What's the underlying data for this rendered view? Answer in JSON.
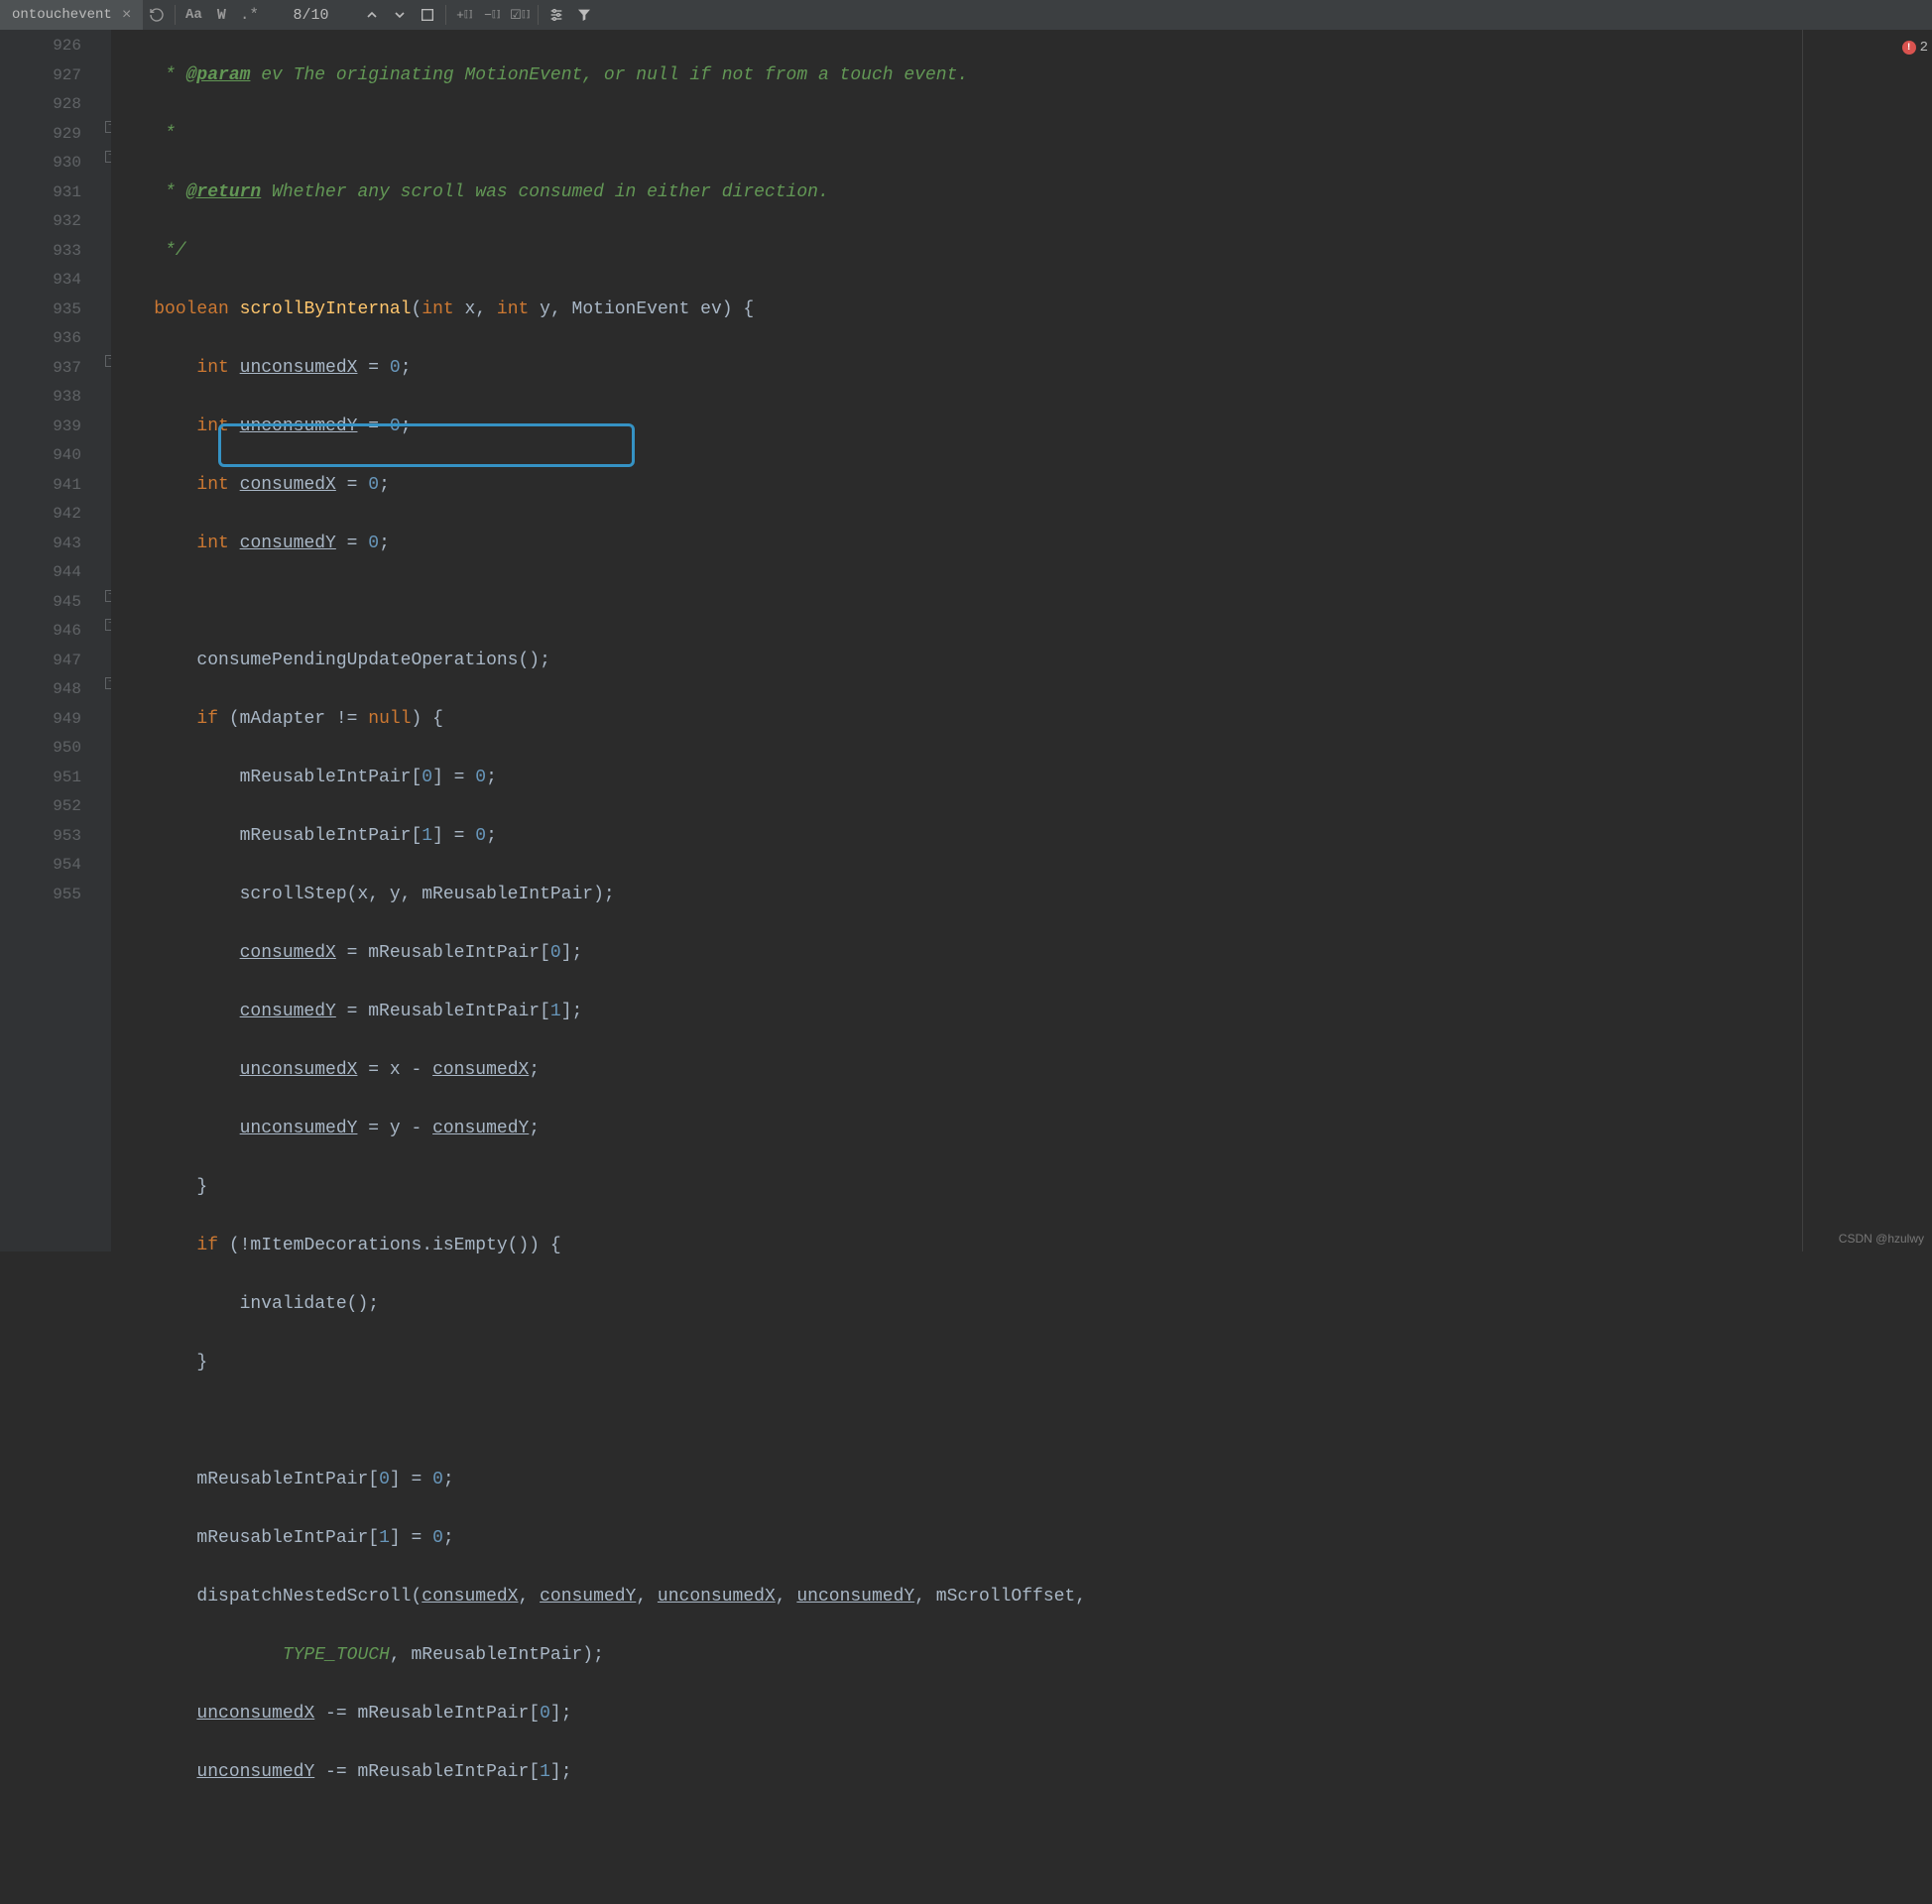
{
  "tab": {
    "label": "ontouchevent"
  },
  "search": {
    "match": "8/10"
  },
  "errors": {
    "count": "2"
  },
  "watermark": "CSDN @hzulwy",
  "gutter": {
    "start": 926,
    "end": 955
  },
  "lines": {
    "l926": {
      "param_text": "ev The originating MotionEvent, or null if not from a touch event."
    },
    "l927": {
      "text": "     *"
    },
    "l928": {
      "return_tag": "@return",
      "return_text": " Whether any scroll was consumed in either direction."
    },
    "l929": {
      "text": "     */"
    },
    "l930": {
      "kw": "boolean",
      "method": "scrollByInternal",
      "sig_int": "int",
      "x": " x",
      "comma1": ", ",
      "y": " y",
      "comma2": ", ",
      "motion": "MotionEvent ev",
      "end": ") {"
    },
    "l931": {
      "int": "int",
      "var": "unconsumedX",
      "eq": " = ",
      "val": "0",
      "semi": ";"
    },
    "l932": {
      "int": "int",
      "var": "unconsumedY",
      "eq": " = ",
      "val": "0",
      "semi": ";"
    },
    "l933": {
      "int": "int",
      "var": "consumedX",
      "eq": " = ",
      "val": "0",
      "semi": ";"
    },
    "l934": {
      "int": "int",
      "var": "consumedY",
      "eq": " = ",
      "val": "0",
      "semi": ";"
    },
    "l936": {
      "call": "consumePendingUpdateOperations();"
    },
    "l937": {
      "if": "if",
      "open": " (mAdapter != ",
      "null": "null",
      "close": ") {"
    },
    "l938": {
      "text": "mReusableIntPair[",
      "idx": "0",
      "mid": "] = ",
      "val": "0",
      "semi": ";"
    },
    "l939": {
      "text": "mReusableIntPair[",
      "idx": "1",
      "mid": "] = ",
      "val": "0",
      "semi": ";"
    },
    "l940": {
      "text": "scrollStep(x, y, mReusableIntPair);"
    },
    "l941": {
      "var": "consumedX",
      "eq": " = mReusableIntPair[",
      "idx": "0",
      "end": "];"
    },
    "l942": {
      "var": "consumedY",
      "eq": " = mReusableIntPair[",
      "idx": "1",
      "end": "];"
    },
    "l943": {
      "var": "unconsumedX",
      "eq": " = x - ",
      "var2": "consumedX",
      "semi": ";"
    },
    "l944": {
      "var": "unconsumedY",
      "eq": " = y - ",
      "var2": "consumedY",
      "semi": ";"
    },
    "l945": {
      "text": "}"
    },
    "l946": {
      "if": "if",
      "text": " (!mItemDecorations.isEmpty()) {"
    },
    "l947": {
      "text": "invalidate();"
    },
    "l948": {
      "text": "}"
    },
    "l950": {
      "text": "mReusableIntPair[",
      "idx": "0",
      "mid": "] = ",
      "val": "0",
      "semi": ";"
    },
    "l951": {
      "text": "mReusableIntPair[",
      "idx": "1",
      "mid": "] = ",
      "val": "0",
      "semi": ";"
    },
    "l952": {
      "call": "dispatchNestedScroll(",
      "a1": "consumedX",
      "c": ", ",
      "a2": "consumedY",
      "a3": "unconsumedX",
      "a4": "unconsumedY",
      "a5": "mScrollOffset",
      "end": ","
    },
    "l953": {
      "touch": "TYPE_TOUCH",
      "rest": ", mReusableIntPair);"
    },
    "l954": {
      "var": "unconsumedX",
      "op": " -= mReusableIntPair[",
      "idx": "0",
      "end": "];"
    },
    "l955": {
      "var": "unconsumedY",
      "op": " -= mReusableIntPair[",
      "idx": "1",
      "end": "];"
    }
  }
}
